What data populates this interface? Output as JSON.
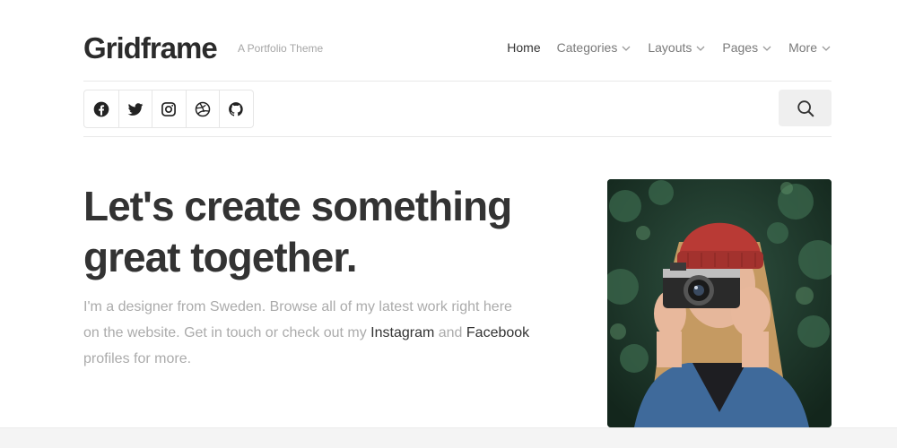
{
  "site": {
    "logo": "Gridframe",
    "tagline": "A Portfolio Theme"
  },
  "nav": [
    {
      "label": "Home",
      "active": true,
      "dropdown": false
    },
    {
      "label": "Categories",
      "active": false,
      "dropdown": true
    },
    {
      "label": "Layouts",
      "active": false,
      "dropdown": true
    },
    {
      "label": "Pages",
      "active": false,
      "dropdown": true
    },
    {
      "label": "More",
      "active": false,
      "dropdown": true
    }
  ],
  "social": [
    "facebook-icon",
    "twitter-icon",
    "instagram-icon",
    "dribbble-icon",
    "github-icon"
  ],
  "search": {
    "icon": "search-icon"
  },
  "hero": {
    "title_line1": "Let's create something",
    "title_line2": "great together.",
    "text_before": "I'm a designer from Sweden. Browse all of my latest work right here on the website. Get in touch or check out my ",
    "link1": "Instagram",
    "text_middle": " and ",
    "link2": "Facebook",
    "text_after": " profiles for more."
  },
  "colors": {
    "text_dark": "#333333",
    "text_muted": "#ababab",
    "nav_muted": "#7a7a7a",
    "rule": "#e9e9e9",
    "search_bg": "#efefef"
  }
}
